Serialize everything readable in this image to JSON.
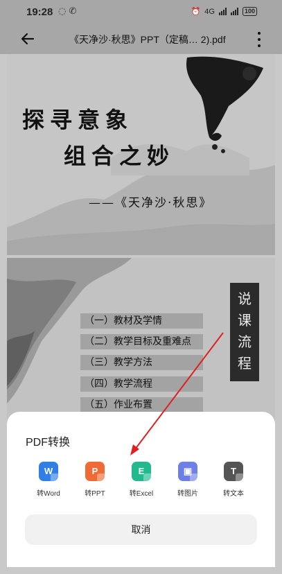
{
  "status_bar": {
    "time": "19:28",
    "network_label": "4G",
    "battery": "100"
  },
  "app_bar": {
    "title": "《天净沙·秋思》PPT（定稿… 2).pdf"
  },
  "slide1": {
    "line1": "探寻意象",
    "line2": "组合之妙",
    "subtitle": "——《天净沙·秋思》"
  },
  "slide2": {
    "toc": [
      "（一）教材及学情",
      "（二）教学目标及重难点",
      "（三）教学方法",
      "（四）教学流程",
      "（五）作业布置"
    ],
    "side_label": [
      "说",
      "课",
      "流",
      "程"
    ]
  },
  "sheet": {
    "title": "PDF转换",
    "options": [
      {
        "label": "转Word",
        "glyph": "W",
        "color": "#2f7fe6",
        "icon": "word-icon"
      },
      {
        "label": "转PPT",
        "glyph": "P",
        "color": "#f06a35",
        "icon": "ppt-icon"
      },
      {
        "label": "转Excel",
        "glyph": "E",
        "color": "#23b98f",
        "icon": "excel-icon"
      },
      {
        "label": "转图片",
        "glyph": "▣",
        "color": "#6f7fe8",
        "icon": "image-icon"
      },
      {
        "label": "转文本",
        "glyph": "T",
        "color": "#555555",
        "icon": "text-icon"
      }
    ],
    "cancel": "取消"
  },
  "colors": {
    "annotation_arrow": "#e02020",
    "overlay_gray": "#a7a7a7"
  }
}
